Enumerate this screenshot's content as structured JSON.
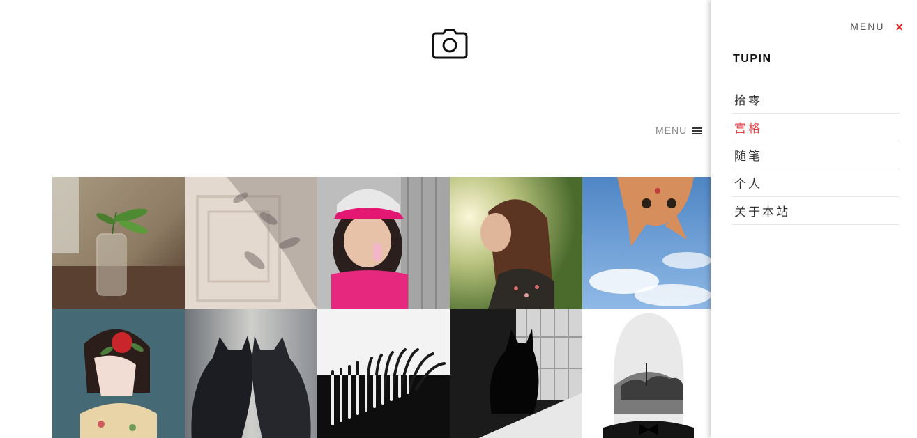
{
  "header": {
    "logo_icon": "camera-icon",
    "menu_label": "MENU",
    "menu_icon": "hamburger-icon"
  },
  "gallery": {
    "photos": [
      {
        "subject": "plant-in-glass-jar"
      },
      {
        "subject": "leaf-shadows-on-door"
      },
      {
        "subject": "girl-with-pink-cap"
      },
      {
        "subject": "woman-in-sunlight"
      },
      {
        "subject": "upside-down-cat-sky"
      },
      {
        "subject": "illustrated-girl-with-rose"
      },
      {
        "subject": "two-black-cats"
      },
      {
        "subject": "burnt-matches"
      },
      {
        "subject": "cat-at-window"
      },
      {
        "subject": "double-exposure-portrait"
      }
    ]
  },
  "drawer": {
    "menu_label": "MENU",
    "close_symbol": "×",
    "close_color": "#e02020",
    "title": "TUPIN",
    "accent_color": "#e0444a",
    "items": [
      {
        "label": "拾零",
        "active": false
      },
      {
        "label": "宫格",
        "active": true
      },
      {
        "label": "随笔",
        "active": false
      },
      {
        "label": "个人",
        "active": false
      },
      {
        "label": "关于本站",
        "active": false
      }
    ]
  }
}
